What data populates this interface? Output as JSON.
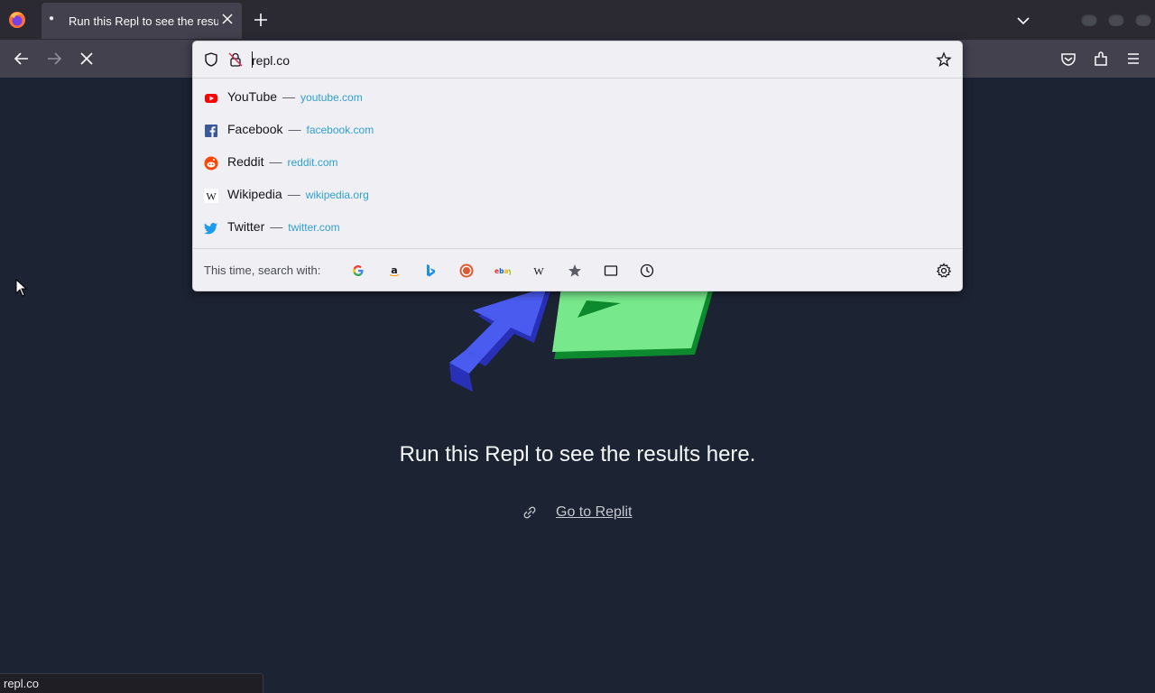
{
  "tab": {
    "title": "Run this Repl to see the results here."
  },
  "urlbar": {
    "value": "repl.co"
  },
  "suggestions": [
    {
      "title": "YouTube",
      "url": "youtube.com"
    },
    {
      "title": "Facebook",
      "url": "facebook.com"
    },
    {
      "title": "Reddit",
      "url": "reddit.com"
    },
    {
      "title": "Wikipedia",
      "url": "wikipedia.org"
    },
    {
      "title": "Twitter",
      "url": "twitter.com"
    }
  ],
  "separator": "—",
  "oneoff": {
    "label": "This time, search with:"
  },
  "page": {
    "message": "Run this Repl to see the results here.",
    "link": "Go to Replit"
  },
  "status": "repl.co",
  "colors": {
    "accent": "#0061e0",
    "page_bg": "#1c2333",
    "chrome_bg": "#2b2a33"
  }
}
